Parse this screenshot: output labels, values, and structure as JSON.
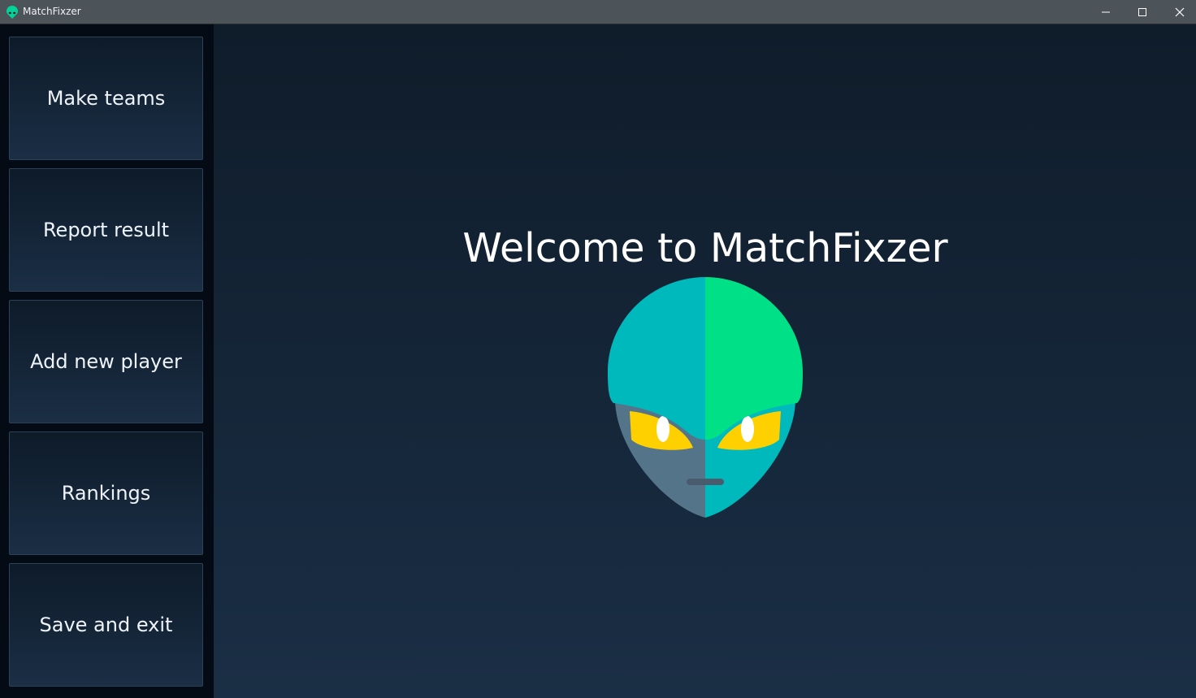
{
  "window": {
    "title": "MatchFixzer"
  },
  "sidebar": {
    "items": [
      {
        "label": "Make teams"
      },
      {
        "label": "Report result"
      },
      {
        "label": "Add new player"
      },
      {
        "label": "Rankings"
      },
      {
        "label": "Save and exit"
      }
    ]
  },
  "main": {
    "welcome_text": "Welcome to MatchFixzer",
    "logo_icon": "alien-head-icon"
  },
  "colors": {
    "titlebar": "#4c5359",
    "sidebar_bg": "#050b14",
    "alien_teal": "#00b9bc",
    "alien_green": "#00e187",
    "alien_face_gray": "#54748a",
    "alien_eyes": "#ffd000"
  }
}
